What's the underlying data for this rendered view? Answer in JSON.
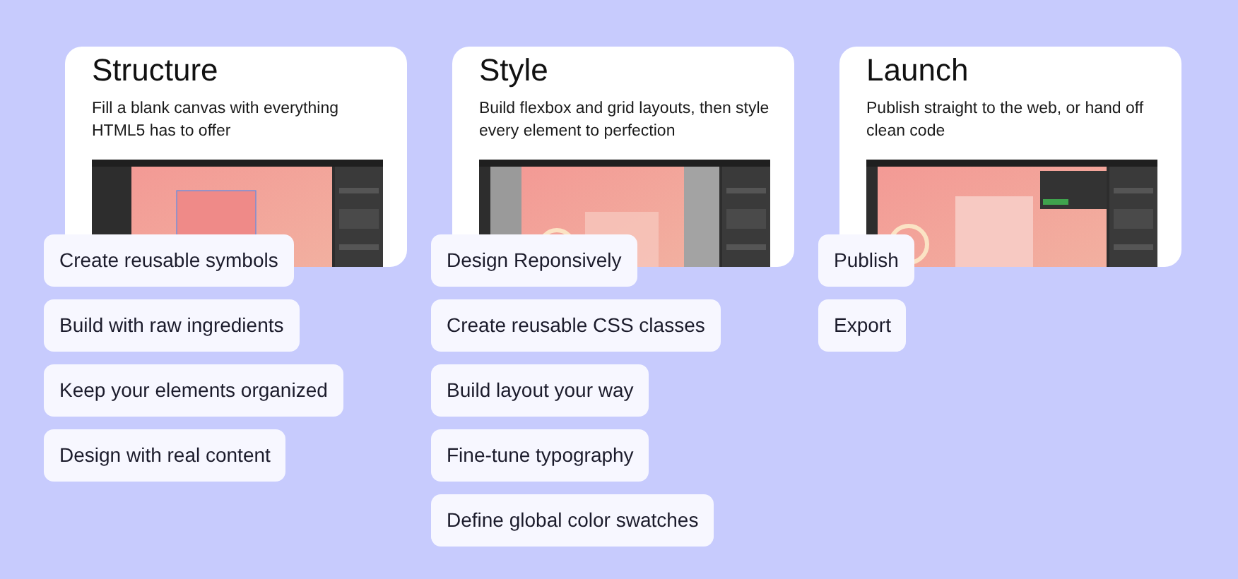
{
  "columns": [
    {
      "title": "Structure",
      "description": "Fill a blank canvas with everything HTML5 has to offer",
      "features": [
        "Create reusable symbols",
        "Build with raw ingredients",
        "Keep your elements organized",
        "Design with real content"
      ]
    },
    {
      "title": "Style",
      "description": "Build flexbox and grid layouts, then style every element to perfection",
      "features": [
        "Design Reponsively",
        "Create reusable CSS classes",
        "Build layout your way",
        "Fine-tune typography",
        "Define global color swatches"
      ]
    },
    {
      "title": "Launch",
      "description": "Publish straight to the web, or hand off clean code",
      "features": [
        "Publish",
        "Export"
      ]
    }
  ]
}
